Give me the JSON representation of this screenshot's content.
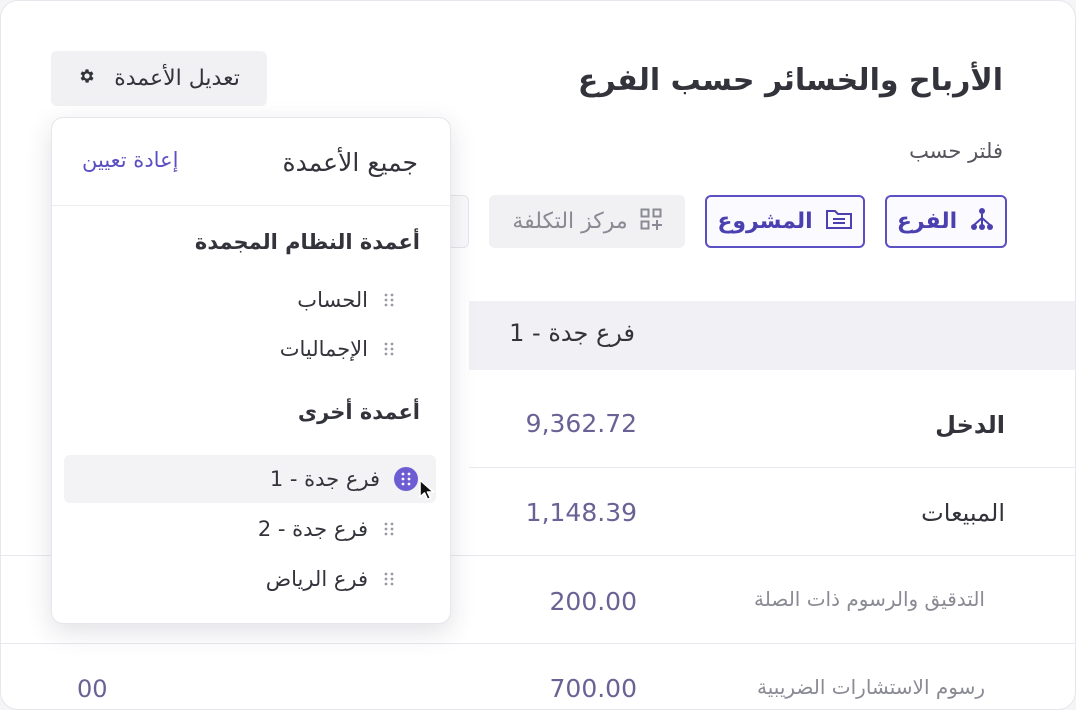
{
  "page": {
    "title": "الأرباح والخسائر حسب الفرع",
    "filter_label": "فلتر حسب",
    "edit_columns_label": "تعديل الأعمدة"
  },
  "filters": [
    {
      "label": "الفرع",
      "icon": "branch-icon",
      "active": true
    },
    {
      "label": "المشروع",
      "icon": "folder-icon",
      "active": true
    },
    {
      "label": "مركز التكلفة",
      "icon": "grid-add-icon",
      "active": false
    }
  ],
  "table": {
    "column_header": "فرع جدة - 1",
    "rows": [
      {
        "label": "الدخل",
        "value": "9,362.72",
        "level": "bold"
      },
      {
        "label": "المبيعات",
        "value": "1,148.39",
        "level": "normal"
      },
      {
        "label": "التدقيق والرسوم ذات الصلة",
        "value": "200.00",
        "level": "sub"
      },
      {
        "label": "رسوم الاستشارات الضريبية",
        "value": "700.00",
        "level": "sub"
      }
    ],
    "cut_off_value": "00"
  },
  "panel": {
    "title": "جميع الأعمدة",
    "reset_label": "إعادة تعيين",
    "frozen_section_title": "أعمدة النظام المجمدة",
    "frozen_columns": [
      "الحساب",
      "الإجماليات"
    ],
    "other_section_title": "أعمدة أخرى",
    "other_columns": [
      "فرع جدة - 1",
      "فرع جدة - 2",
      "فرع الرياض"
    ]
  },
  "colors": {
    "accent": "#5b4fc4",
    "text": "#33333b",
    "muted": "#8a8a94",
    "value": "#6a6294"
  }
}
